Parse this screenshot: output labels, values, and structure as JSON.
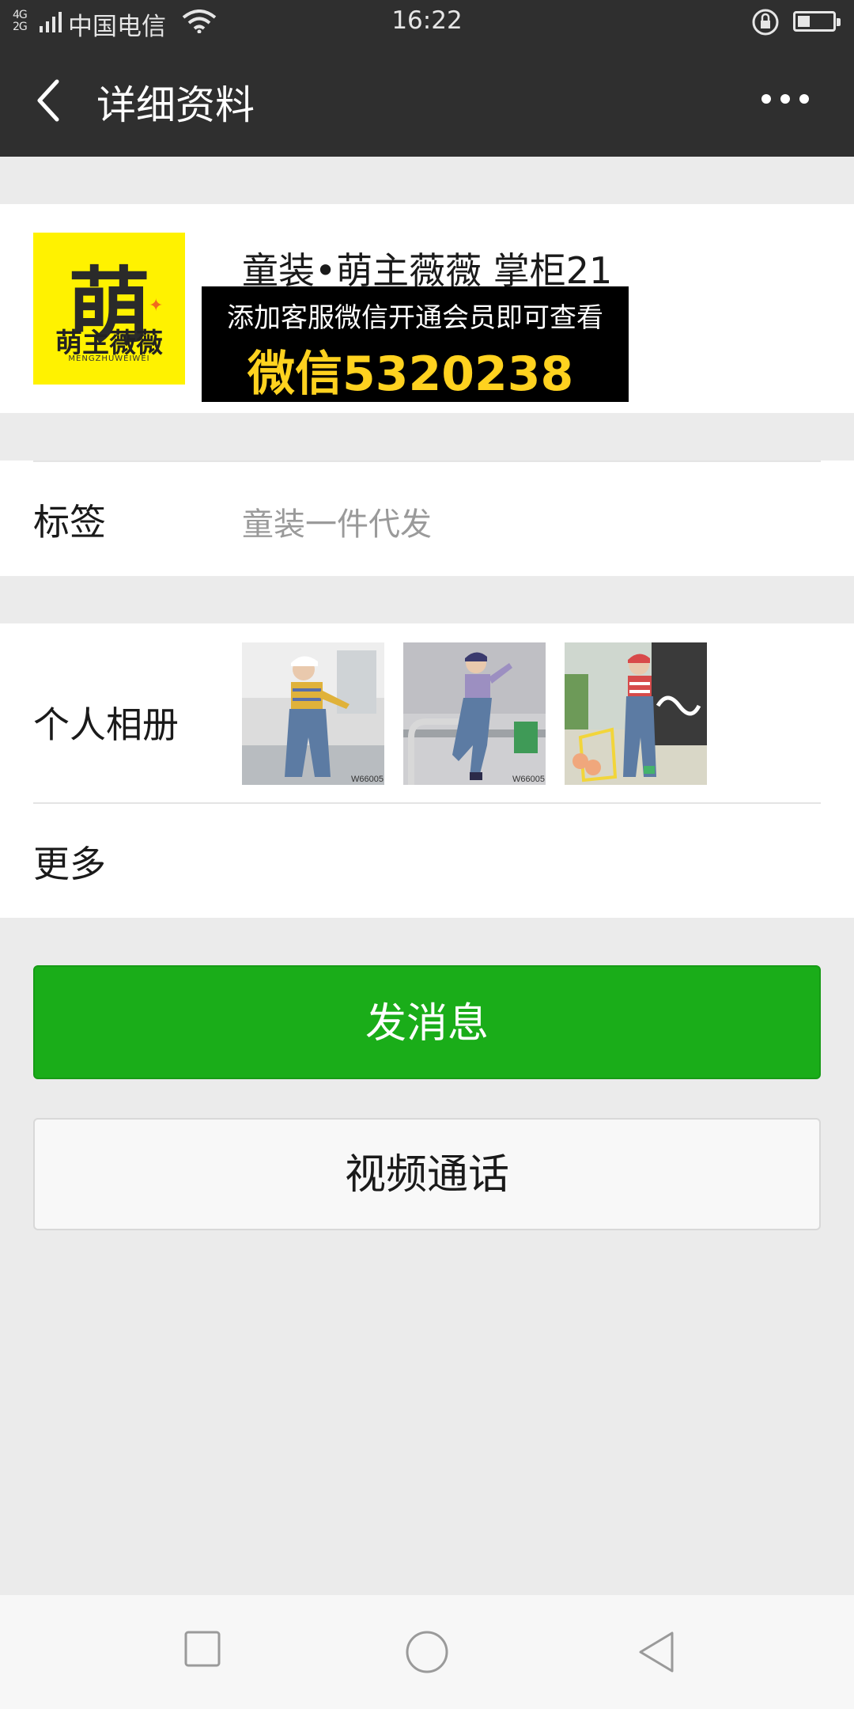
{
  "status_bar": {
    "network_top": "4G",
    "network_bottom": "2G",
    "carrier": "中国电信",
    "time": "16:22",
    "icons": [
      "signal-icon",
      "wifi-icon",
      "rotation-lock-icon",
      "battery-icon"
    ],
    "battery_level_percent": 30
  },
  "header": {
    "title": "详细资料",
    "back_icon": "chevron-left-icon",
    "more_icon": "more-dots-icon"
  },
  "profile": {
    "name": "童装•萌主薇薇 掌柜21",
    "avatar": {
      "char": "萌",
      "brand": "萌主薇薇",
      "sub": "MENGZHUWEIWEI"
    },
    "promo": {
      "line1": "添加客服微信开通会员即可查看",
      "line2": "微信5320238"
    }
  },
  "tags": {
    "label": "标签",
    "value": "童装一件代发"
  },
  "album": {
    "label": "个人相册",
    "photos": [
      {
        "caption": "W66005"
      },
      {
        "caption": "W66005"
      },
      {
        "caption": ""
      }
    ]
  },
  "more": {
    "label": "更多"
  },
  "actions": {
    "send_message": "发消息",
    "video_call": "视频通话"
  },
  "system_nav": {
    "icons": [
      "recent-apps-icon",
      "home-icon",
      "back-triangle-icon"
    ]
  },
  "colors": {
    "header_bg": "#2f2f2f",
    "page_bg": "#ebebeb",
    "primary_button": "#1aad19",
    "promo_yellow": "#ffd21f",
    "avatar_yellow": "#fff200"
  }
}
